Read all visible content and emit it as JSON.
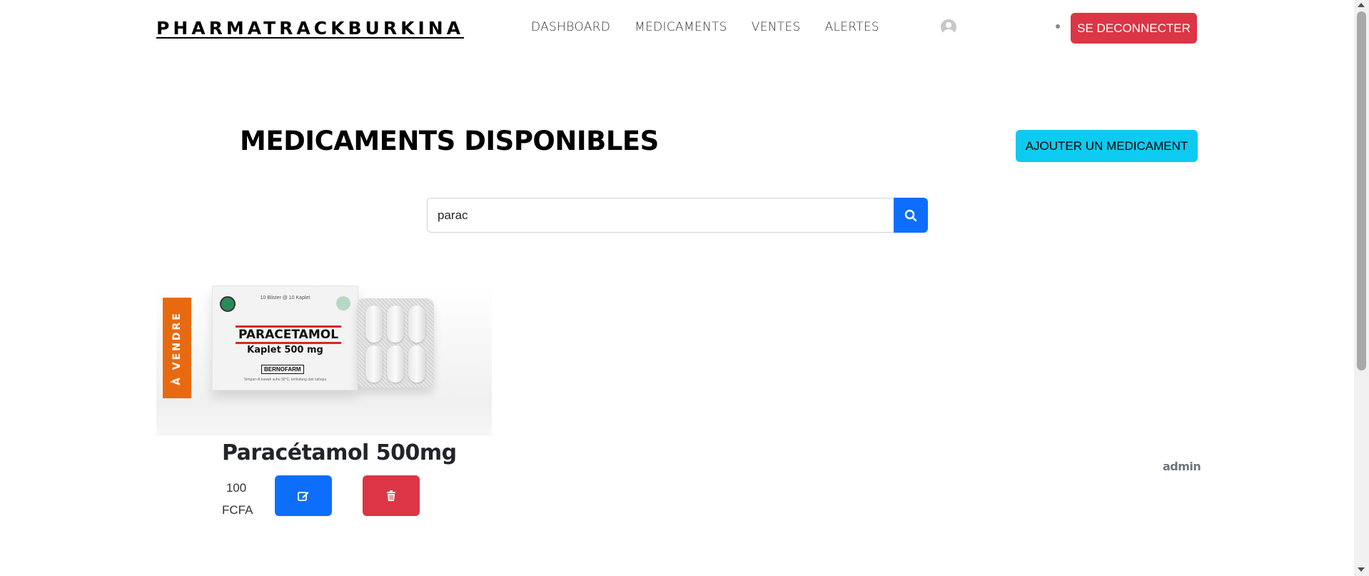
{
  "header": {
    "brand": "PHARMATRACKBURKINA",
    "nav": [
      "DASHBOARD",
      "MEDICAMENTS",
      "VENTES",
      "ALERTES"
    ],
    "user": "admin",
    "logout_label": "SE DECONNECTER"
  },
  "main": {
    "title": "MEDICAMENTS DISPONIBLES",
    "add_label": "AJOUTER UN MEDICAMENT",
    "search_value": "parac"
  },
  "product": {
    "ribbon": "À VENDRE",
    "name": "Paracétamol 500mg",
    "price_amount": "100",
    "price_currency": "FCFA",
    "image": {
      "top_text": "10 Blister @ 10 Kaplet",
      "brand": "PARACETAMOL",
      "subtitle": "Kaplet 500 mg",
      "maker": "BERNOFARM",
      "note": "Simpan di bawah suhu 30°C, terlindung dari cahaya"
    }
  },
  "colors": {
    "primary": "#0d6efd",
    "danger": "#dc3545",
    "info": "#0dcaf0",
    "ribbon": "#e86a10"
  }
}
